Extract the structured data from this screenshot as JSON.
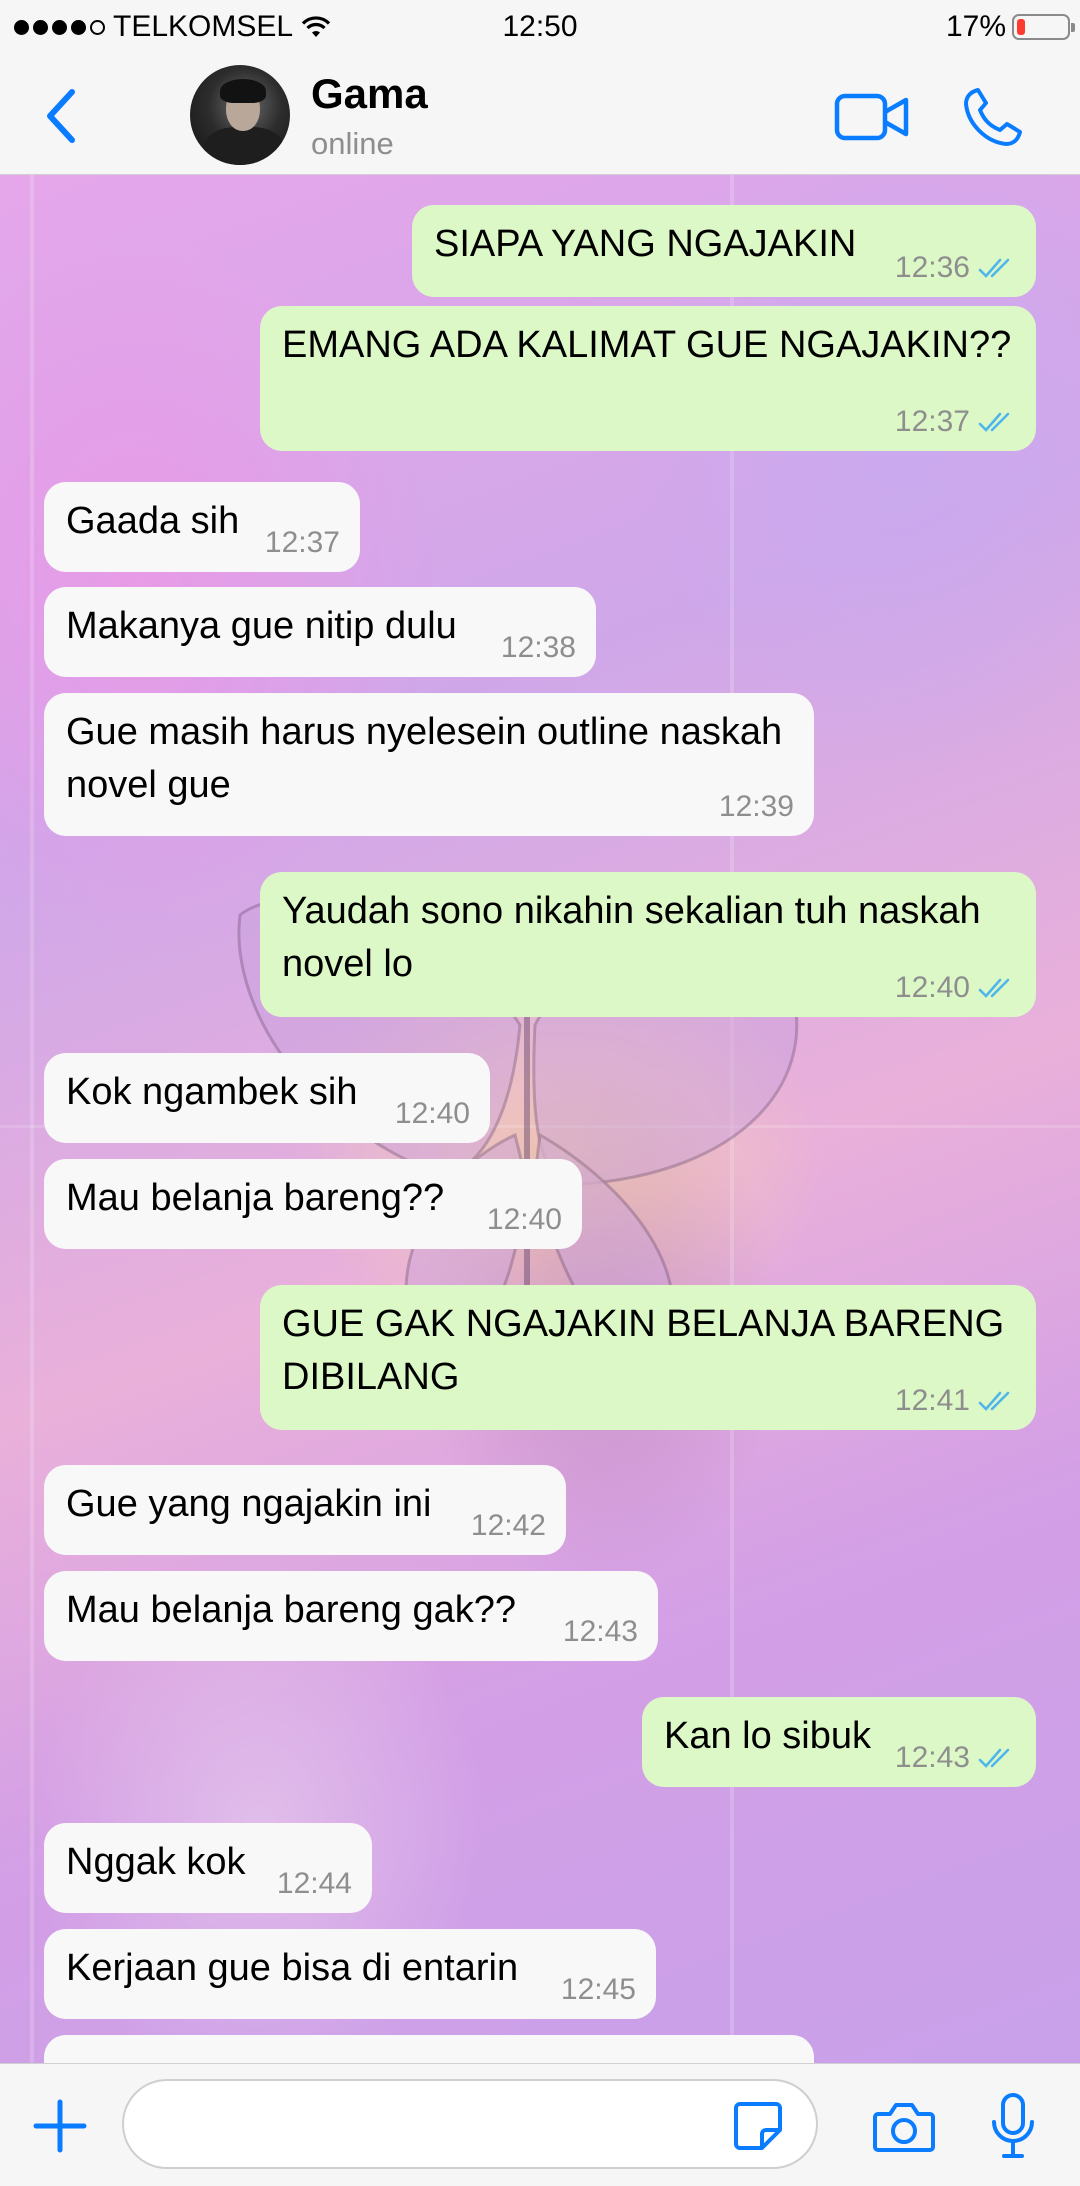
{
  "status_bar": {
    "carrier": "TELKOMSEL",
    "time": "12:50",
    "battery": "17%",
    "battery_level": 0.17
  },
  "header": {
    "back_icon": "chevron-left-icon",
    "contact_name": "Gama",
    "contact_status": "online",
    "video_icon": "video-camera-icon",
    "call_icon": "phone-icon"
  },
  "messages": [
    {
      "direction": "out",
      "text": "SIAPA YANG NGAJAKIN",
      "time": "12:36",
      "read": true
    },
    {
      "direction": "out",
      "text": "EMANG ADA KALIMAT GUE NGAJAKIN??",
      "time": "12:37",
      "read": true
    },
    {
      "direction": "in",
      "text": "Gaada sih",
      "time": "12:37"
    },
    {
      "direction": "in",
      "text": "Makanya gue nitip dulu",
      "time": "12:38"
    },
    {
      "direction": "in",
      "text": "Gue masih harus nyelesein outline naskah novel gue",
      "time": "12:39"
    },
    {
      "direction": "out",
      "text": "Yaudah sono nikahin sekalian tuh naskah novel lo",
      "time": "12:40",
      "read": true
    },
    {
      "direction": "in",
      "text": "Kok ngambek sih",
      "time": "12:40"
    },
    {
      "direction": "in",
      "text": "Mau belanja bareng??",
      "time": "12:40"
    },
    {
      "direction": "out",
      "text": "GUE GAK NGAJAKIN BELANJA BARENG DIBILANG",
      "time": "12:41",
      "read": true
    },
    {
      "direction": "in",
      "text": "Gue yang ngajakin ini",
      "time": "12:42"
    },
    {
      "direction": "in",
      "text": "Mau belanja bareng gak??",
      "time": "12:43"
    },
    {
      "direction": "out",
      "text": "Kan lo sibuk",
      "time": "12:43",
      "read": true
    },
    {
      "direction": "in",
      "text": "Nggak kok",
      "time": "12:44"
    },
    {
      "direction": "in",
      "text": "Kerjaan gue bisa di entarin",
      "time": "12:45"
    }
  ],
  "input_bar": {
    "placeholder": "",
    "plus_icon": "plus-icon",
    "sticker_icon": "sticker-icon",
    "camera_icon": "camera-icon",
    "mic_icon": "microphone-icon"
  },
  "colors": {
    "accent": "#0a7cff",
    "bubble_out": "#dcf8c6",
    "bubble_in": "#f8f8f8",
    "read_ticks": "#4fb6ec",
    "battery_low": "#ff3b30"
  }
}
